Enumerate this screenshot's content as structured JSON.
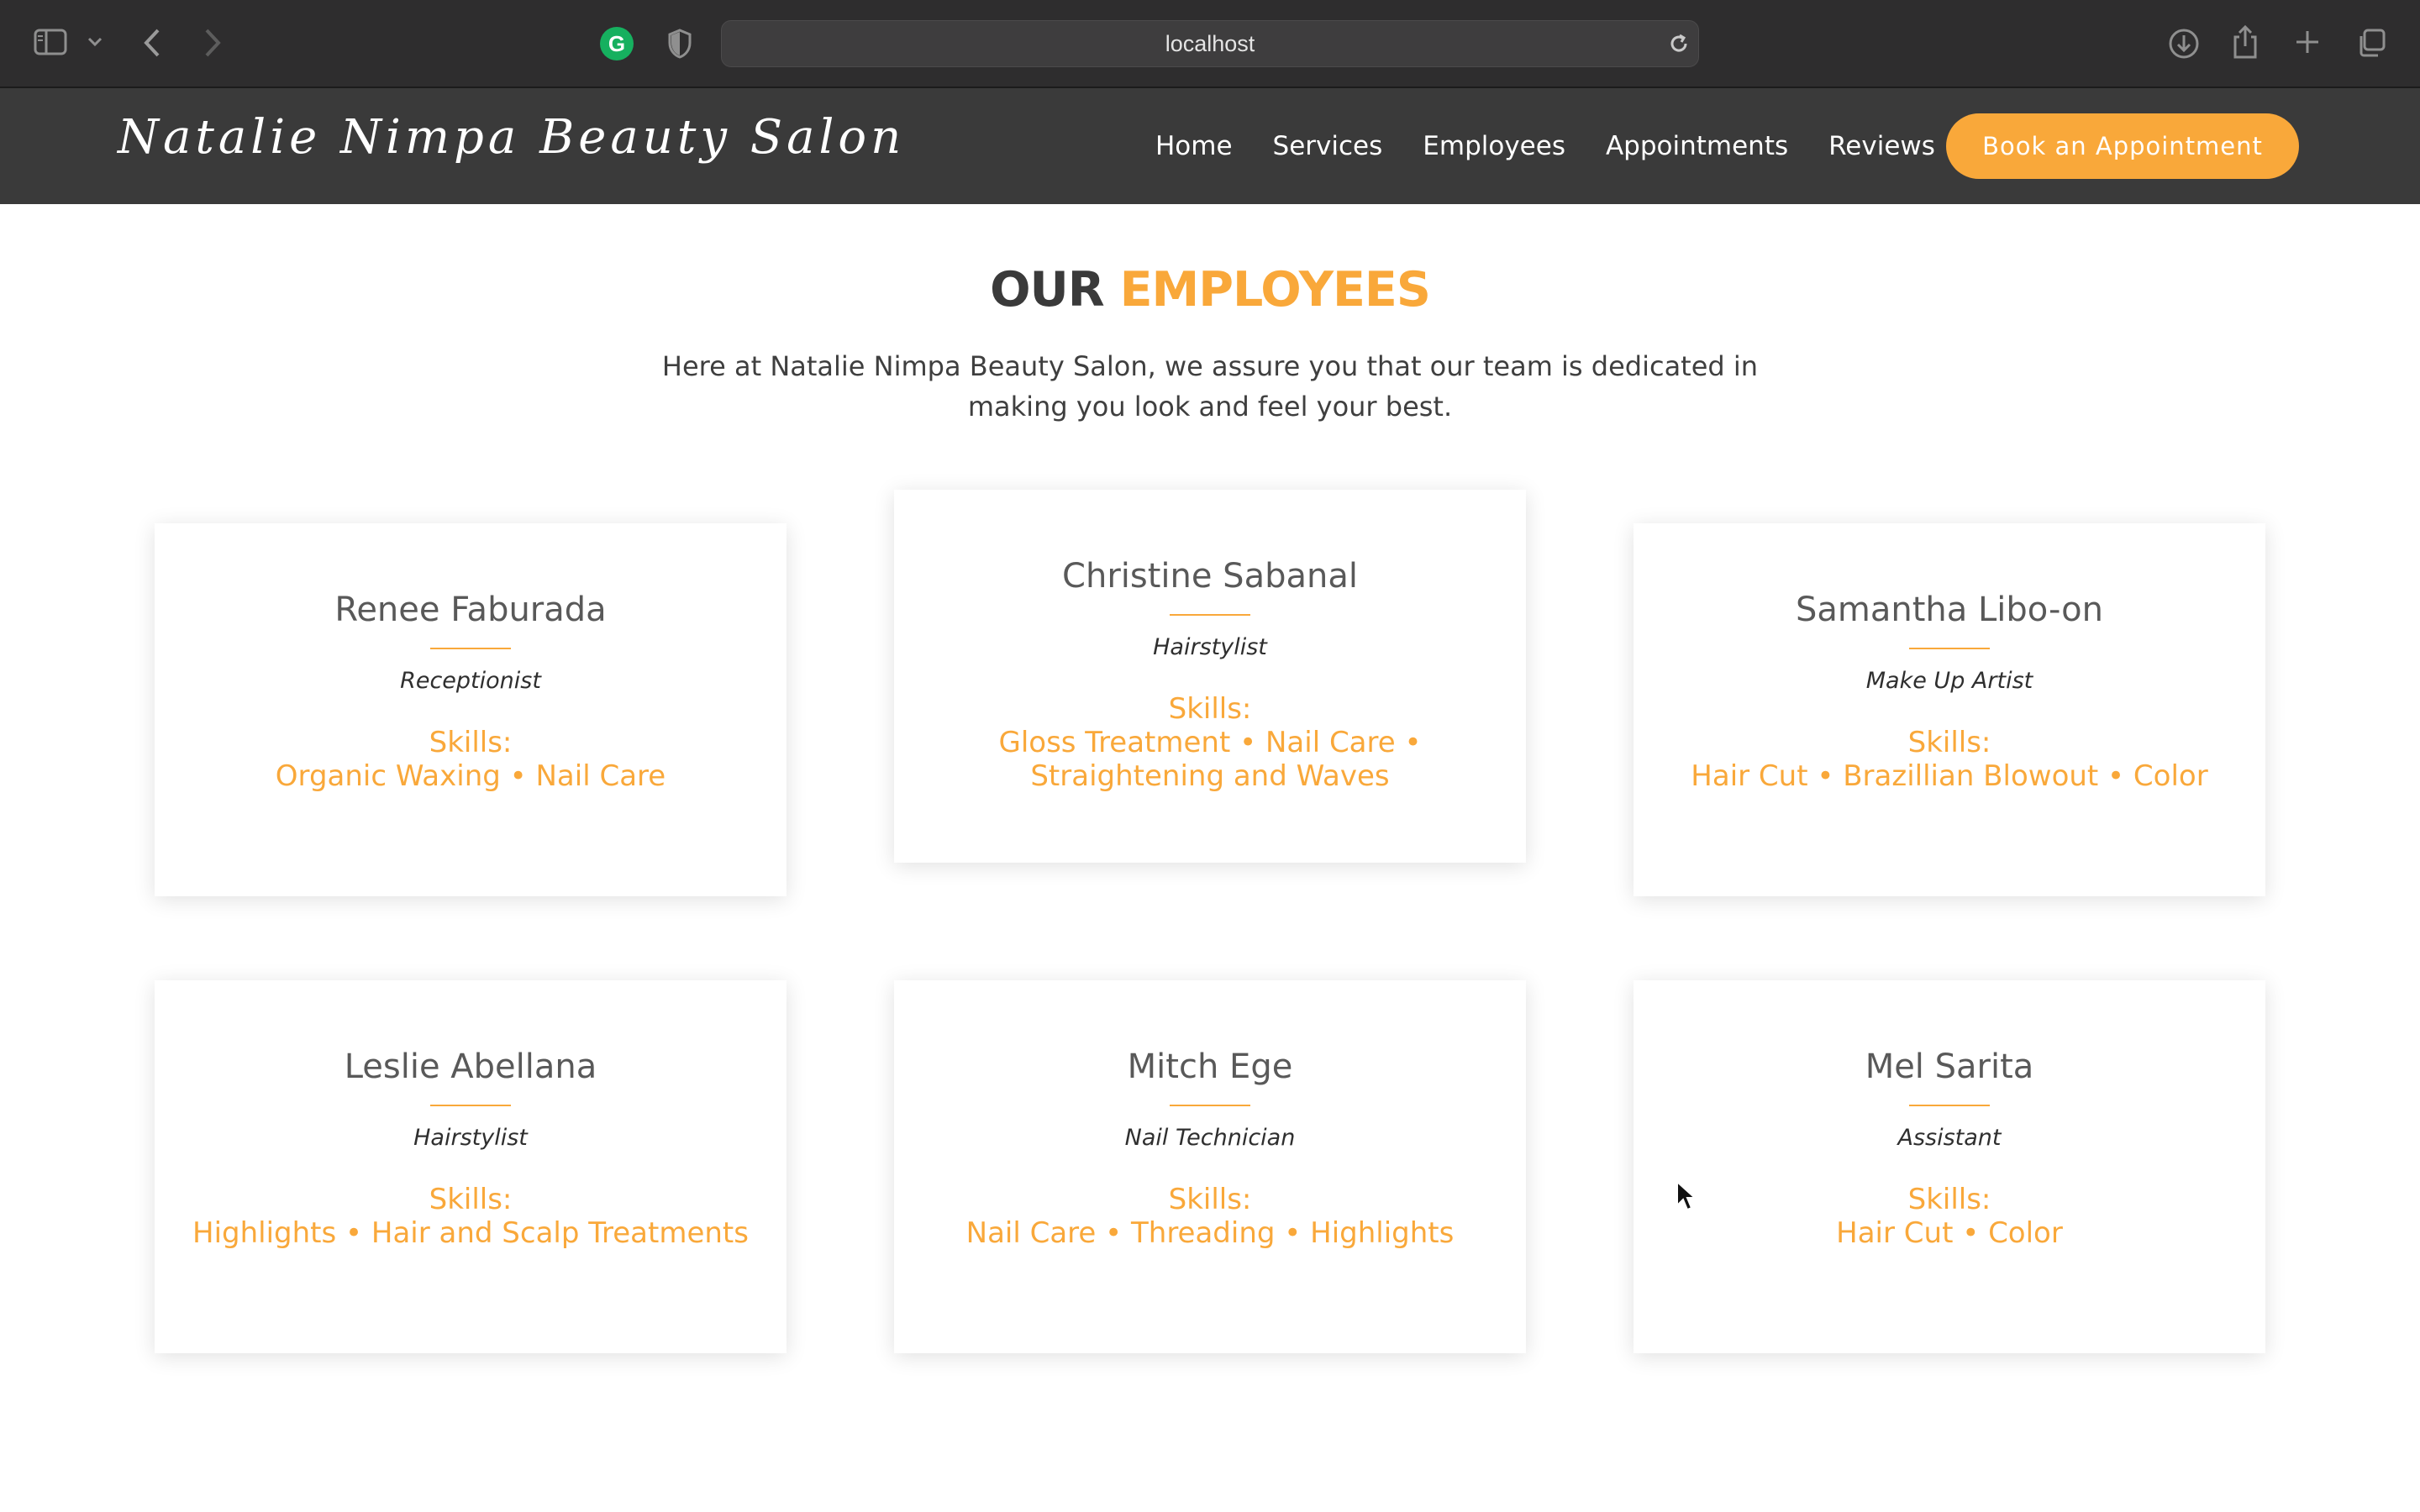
{
  "browser": {
    "url": "localhost",
    "grammarly_letter": "G"
  },
  "header": {
    "brand": "Natalie Nimpa Beauty Salon",
    "nav": [
      "Home",
      "Services",
      "Employees",
      "Appointments",
      "Reviews"
    ],
    "cta_label": "Book an Appointment"
  },
  "section": {
    "title_dark": "OUR",
    "title_accent": "EMPLOYEES",
    "intro": "Here at Natalie Nimpa Beauty Salon, we assure you that our team is dedicated in making you look and feel your best."
  },
  "skills_label": "Skills:",
  "employees": [
    {
      "name": "Renee Faburada",
      "role": "Receptionist",
      "skills": "Organic Waxing • Nail Care"
    },
    {
      "name": "Christine Sabanal",
      "role": "Hairstylist",
      "skills": "Gloss Treatment • Nail Care • Straightening and Waves"
    },
    {
      "name": "Samantha Libo-on",
      "role": "Make Up Artist",
      "skills": "Hair Cut • Brazillian Blowout • Color"
    },
    {
      "name": "Leslie Abellana",
      "role": "Hairstylist",
      "skills": "Highlights • Hair and Scalp Treatments"
    },
    {
      "name": "Mitch Ege",
      "role": "Nail Technician",
      "skills": "Nail Care • Threading • Highlights"
    },
    {
      "name": "Mel Sarita",
      "role": "Assistant",
      "skills": "Hair Cut • Color"
    }
  ],
  "colors": {
    "accent": "#f9a83a",
    "header_bg": "#3a3a3a",
    "browser_bg": "#2e2d2e"
  }
}
